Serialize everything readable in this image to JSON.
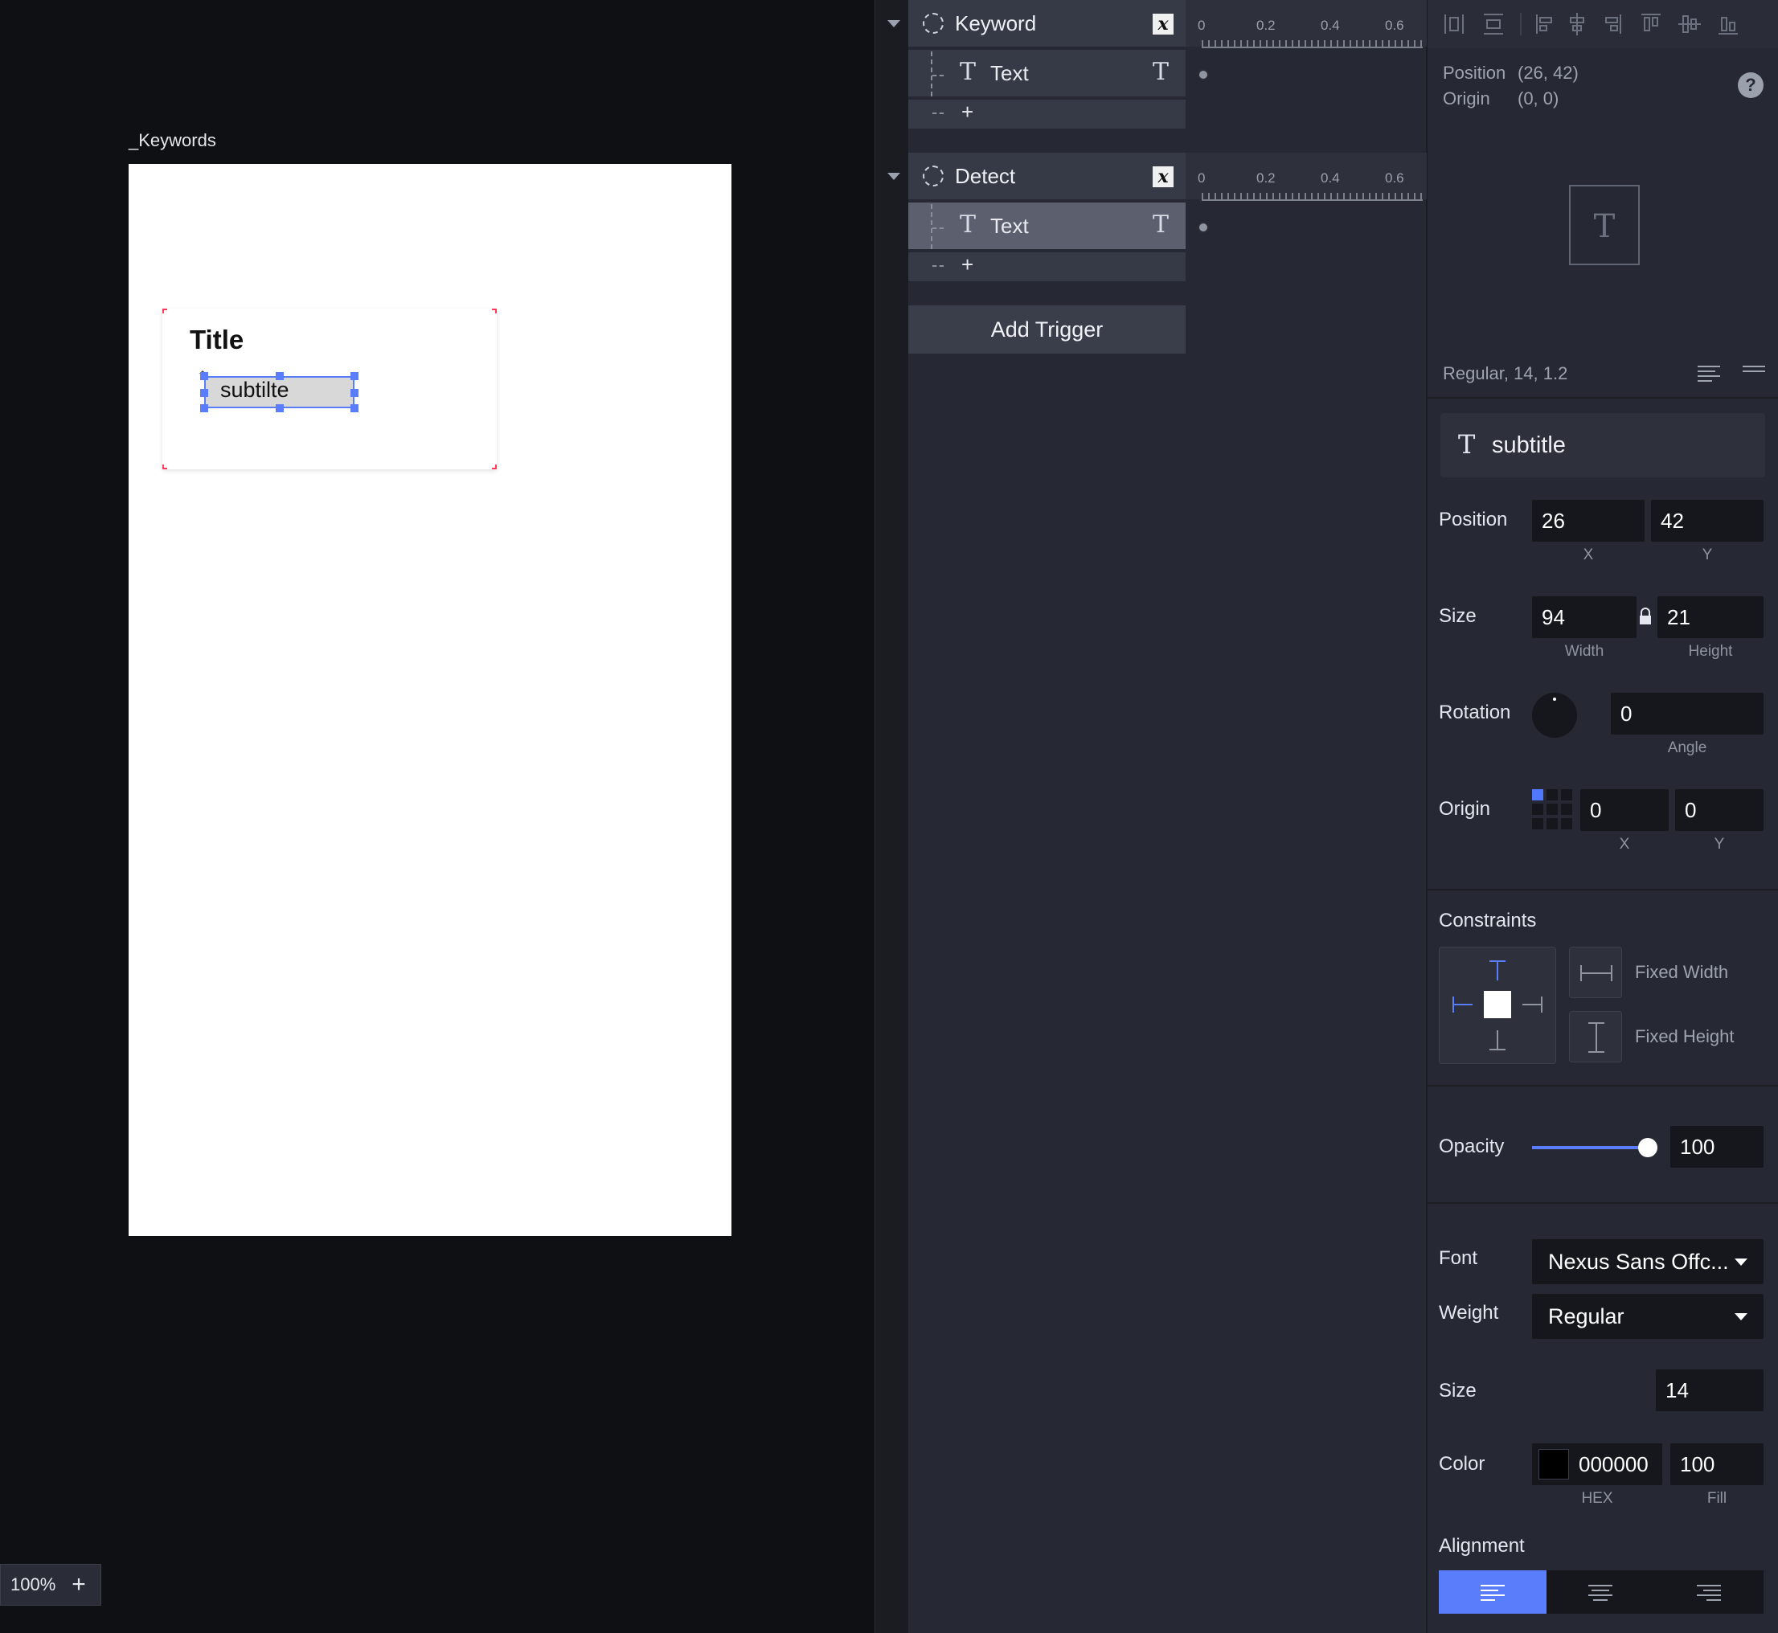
{
  "canvas": {
    "frame_label": "_Keywords",
    "card_title": "Title",
    "selected_text": "subtilte",
    "zoom": "100%",
    "zoom_plus": "+"
  },
  "triggers": [
    {
      "name": "Keyword",
      "badge": "x",
      "child_icon": "T",
      "child_label": "Text",
      "child_type_icon": "T",
      "add": "+"
    },
    {
      "name": "Detect",
      "badge": "x",
      "child_icon": "T",
      "child_label": "Text",
      "child_type_icon": "T",
      "add": "+"
    }
  ],
  "timeline": {
    "ticks": [
      "0",
      "0.2",
      "0.4",
      "0.6"
    ]
  },
  "add_trigger_label": "Add Trigger",
  "inspector": {
    "info_position_label": "Position",
    "info_position_value": "(26, 42)",
    "info_origin_label": "Origin",
    "info_origin_value": "(0, 0)",
    "help": "?",
    "preview_glyph": "T",
    "text_style_summary": "Regular, 14, 1.2",
    "layer_icon": "T",
    "layer_name": "subtitle",
    "position": {
      "label": "Position",
      "x": "26",
      "y": "42",
      "x_sub": "X",
      "y_sub": "Y"
    },
    "size": {
      "label": "Size",
      "width": "94",
      "height": "21",
      "width_sub": "Width",
      "height_sub": "Height"
    },
    "rotation": {
      "label": "Rotation",
      "angle": "0",
      "angle_sub": "Angle"
    },
    "origin": {
      "label": "Origin",
      "x": "0",
      "y": "0",
      "x_sub": "X",
      "y_sub": "Y"
    },
    "constraints": {
      "label": "Constraints",
      "fixed_width": "Fixed Width",
      "fixed_height": "Fixed Height"
    },
    "opacity": {
      "label": "Opacity",
      "value": "100",
      "level": 1.0
    },
    "font": {
      "label": "Font",
      "value": "Nexus Sans Offc..."
    },
    "weight": {
      "label": "Weight",
      "value": "Regular"
    },
    "font_size": {
      "label": "Size",
      "value": "14"
    },
    "color": {
      "label": "Color",
      "hex": "000000",
      "fill": "100",
      "hex_sub": "HEX",
      "fill_sub": "Fill",
      "swatch": "#000000"
    },
    "alignment": {
      "label": "Alignment",
      "selected": "left"
    }
  },
  "colors": {
    "accent": "#5a7dfb",
    "panel": "#262934",
    "canvas_bg": "#0f1014"
  }
}
